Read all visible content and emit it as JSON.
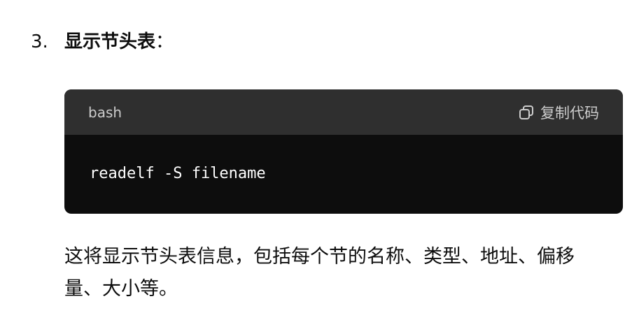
{
  "list_item": {
    "number": "3.",
    "title": "显示节头表",
    "suffix": "："
  },
  "code_block": {
    "language": "bash",
    "copy_label": "复制代码",
    "copy_icon": "copy-icon",
    "code": "readelf -S filename"
  },
  "paragraph": {
    "text": "这将显示节头表信息，包括每个节的名称、类型、地址、偏移量、大小等。"
  }
}
